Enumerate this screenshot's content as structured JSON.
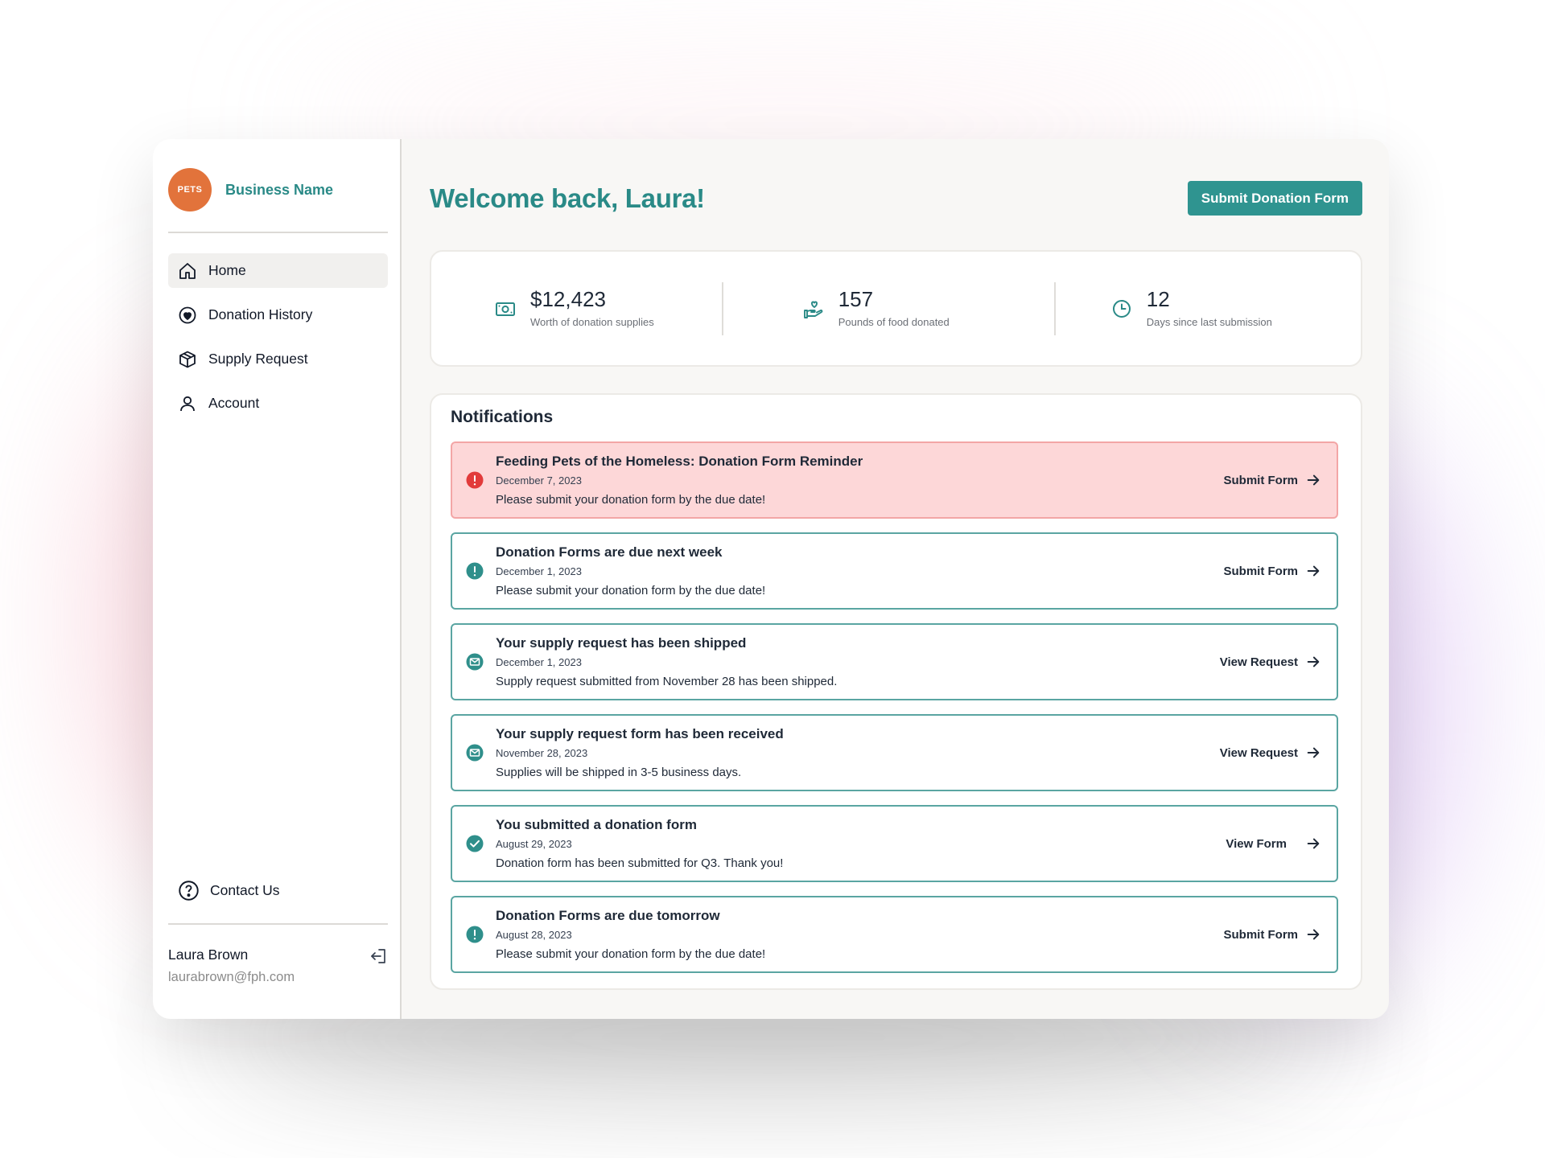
{
  "brand": {
    "name": "Business Name",
    "logo_text": "PETS"
  },
  "nav": [
    {
      "label": "Home",
      "icon": "home-icon",
      "active": true
    },
    {
      "label": "Donation History",
      "icon": "heart-circle-icon"
    },
    {
      "label": "Supply Request",
      "icon": "box-icon"
    },
    {
      "label": "Account",
      "icon": "user-icon"
    }
  ],
  "contact": {
    "label": "Contact Us"
  },
  "user": {
    "name": "Laura Brown",
    "email": "laurabrown@fph.com"
  },
  "header": {
    "title": "Welcome back, Laura!",
    "cta": "Submit Donation Form"
  },
  "stats": [
    {
      "value": "$12,423",
      "label": "Worth of donation supplies",
      "icon": "money-icon"
    },
    {
      "value": "157",
      "label": "Pounds of food donated",
      "icon": "hand-heart-icon"
    },
    {
      "value": "12",
      "label": "Days since last submission",
      "icon": "clock-icon"
    }
  ],
  "notifications": {
    "title": "Notifications",
    "items": [
      {
        "title": "Feeding Pets of the Homeless: Donation Form Reminder",
        "date": "December 7, 2023",
        "body": "Please submit your donation form by the due date!",
        "action": "Submit Form",
        "icon": "alert-icon",
        "urgent": true
      },
      {
        "title": "Donation Forms are due next week",
        "date": "December 1, 2023",
        "body": "Please submit your donation form by the due date!",
        "action": "Submit Form",
        "icon": "alert-icon"
      },
      {
        "title": "Your supply request has been shipped",
        "date": "December 1, 2023",
        "body": "Supply request submitted from November 28 has been shipped.",
        "action": "View Request",
        "icon": "mail-icon"
      },
      {
        "title": "Your supply request form has been received",
        "date": "November 28, 2023",
        "body": "Supplies will be shipped in 3-5 business days.",
        "action": "View Request",
        "icon": "mail-icon"
      },
      {
        "title": "You submitted a donation form",
        "date": "August 29, 2023",
        "body": "Donation form has been submitted for Q3. Thank you!",
        "action": "View Form",
        "icon": "check-icon"
      },
      {
        "title": "Donation Forms are due tomorrow",
        "date": "August 28, 2023",
        "body": "Please submit your donation form by the due date!",
        "action": "Submit Form",
        "icon": "alert-icon"
      }
    ]
  },
  "colors": {
    "accent": "#2a8a87",
    "button": "#2f9490",
    "urgent_bg": "#fdd7d8",
    "urgent_icon": "#e23b3b",
    "brand_logo": "#e2733b"
  }
}
